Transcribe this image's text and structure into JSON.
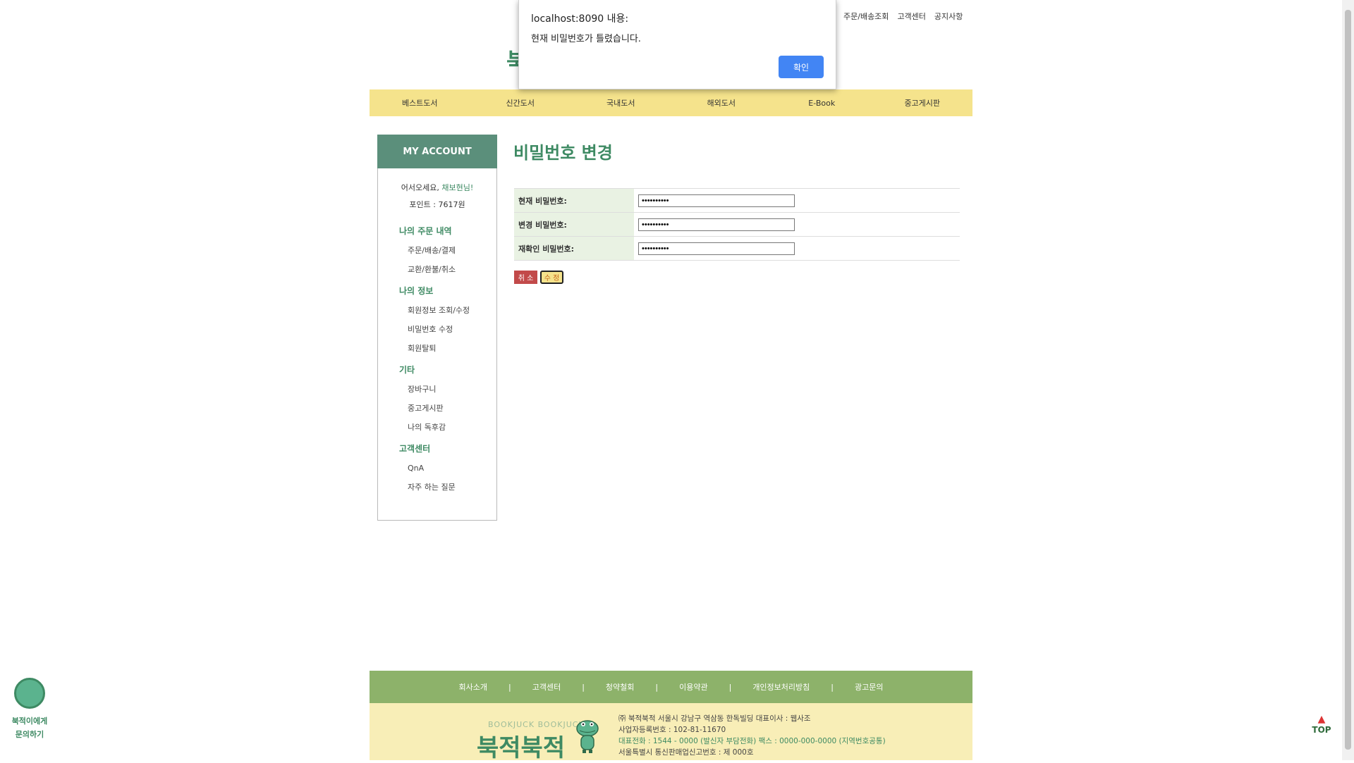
{
  "top_links": [
    "주문/배송조회",
    "고객센터",
    "공지사항"
  ],
  "logo_peek": "북",
  "nav": [
    "베스트도서",
    "신간도서",
    "국내도서",
    "해외도서",
    "E-Book",
    "중고게시판"
  ],
  "sidebar": {
    "title": "MY ACCOUNT",
    "welcome_prefix": "어서오세요,",
    "user": "채보현님!",
    "points": "포인트 : 7617원",
    "sections": [
      {
        "title": "나의 주문 내역",
        "links": [
          "주문/배송/결제",
          "교환/환불/취소"
        ]
      },
      {
        "title": "나의 정보",
        "links": [
          "회원정보 조회/수정",
          "비밀번호 수정",
          "회원탈퇴"
        ]
      },
      {
        "title": "기타",
        "links": [
          "장바구니",
          "중고게시판",
          "나의 독후감"
        ]
      },
      {
        "title": "고객센터",
        "links": [
          "QnA",
          "자주 하는 질문"
        ]
      }
    ]
  },
  "page_title": "비밀번호 변경",
  "form": {
    "rows": [
      {
        "label": "현재 비밀번호:",
        "value": "••••••••••"
      },
      {
        "label": "변경 비밀번호:",
        "value": "••••••••••"
      },
      {
        "label": "재확인 비밀번호:",
        "value": "••••••••••"
      }
    ],
    "cancel_label": "취 소",
    "modify_label": "수 정"
  },
  "dialog": {
    "title": "localhost:8090 내용:",
    "message": "현재 비밀번호가 틀렸습니다.",
    "ok_label": "확인"
  },
  "footer": {
    "links": [
      "회사소개",
      "고객센터",
      "청약철회",
      "이용약관",
      "개인정보처리방침",
      "광고문의"
    ],
    "separator": "|",
    "logo_small": "BOOKJUCK BOOKJUCK",
    "logo_big": "북적북적",
    "info": [
      "㈜ 북적북적    서울시 강남구 역삼동 한독빌딩    대표이사 : 웹사조",
      "사업자등록번호 : 102-81-11670",
      "대표전화 : 1544 - 0000 (발신자 부담전화)    팩스 : 0000-000-0000 (지역번호공통)",
      "서울특별시 통신판매업신고번호 : 제 000호"
    ]
  },
  "chat_float": {
    "line1": "북적이에게",
    "line2": "문의하기"
  },
  "top_button": "TOP"
}
